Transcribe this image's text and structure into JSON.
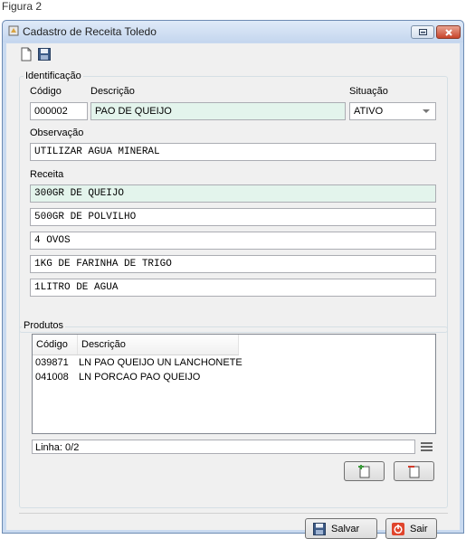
{
  "caption": "Figura 2",
  "window": {
    "title": "Cadastro de Receita Toledo"
  },
  "toolbar": {
    "new_icon": "document-icon",
    "save_icon": "floppy-icon"
  },
  "identificacao": {
    "legend": "Identificação",
    "codigo_label": "Código",
    "codigo_value": "000002",
    "descricao_label": "Descrição",
    "descricao_value": "PAO DE QUEIJO",
    "situacao_label": "Situação",
    "situacao_value": "ATIVO",
    "observacao_label": "Observação",
    "observacao_value": "UTILIZAR AGUA MINERAL",
    "receita_label": "Receita",
    "receita_lines": [
      "300GR DE QUEIJO",
      "500GR DE POLVILHO",
      "4 OVOS",
      "1KG DE FARINHA DE TRIGO",
      "1LITRO DE AGUA"
    ]
  },
  "produtos": {
    "legend": "Produtos",
    "columns": [
      "Código",
      "Descrição"
    ],
    "rows": [
      [
        "039871",
        "LN PAO QUEIJO UN LANCHONETE"
      ],
      [
        "041008",
        "LN PORCAO PAO QUEIJO"
      ]
    ],
    "status": "Linha: 0/2"
  },
  "footer": {
    "save_label": "Salvar",
    "exit_label": "Sair"
  }
}
